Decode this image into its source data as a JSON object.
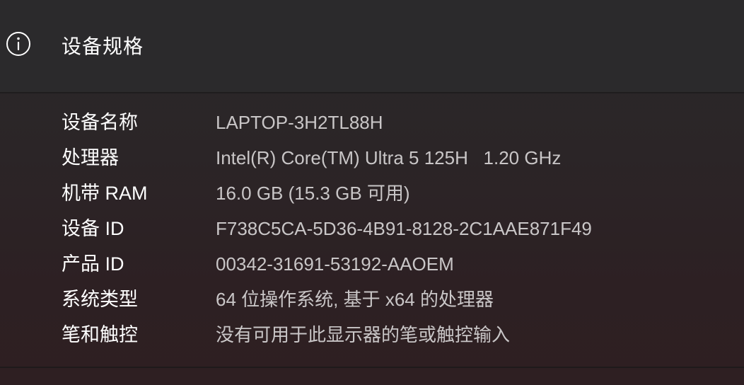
{
  "section": {
    "title": "设备规格",
    "icon": "info-icon"
  },
  "specs": [
    {
      "label": "设备名称",
      "value": "LAPTOP-3H2TL88H"
    },
    {
      "label": "处理器",
      "value": "Intel(R) Core(TM) Ultra 5 125H   1.20 GHz"
    },
    {
      "label": "机带 RAM",
      "value": "16.0 GB (15.3 GB 可用)"
    },
    {
      "label": "设备 ID",
      "value": "F738C5CA-5D36-4B91-8128-2C1AAE871F49"
    },
    {
      "label": "产品 ID",
      "value": "00342-31691-53192-AAOEM"
    },
    {
      "label": "系统类型",
      "value": "64 位操作系统, 基于 x64 的处理器"
    },
    {
      "label": "笔和触控",
      "value": "没有可用于此显示器的笔或触控输入"
    }
  ],
  "colors": {
    "label": "#ffffff",
    "value": "#c9c6c7",
    "header_bg": "#2b2a2c"
  }
}
